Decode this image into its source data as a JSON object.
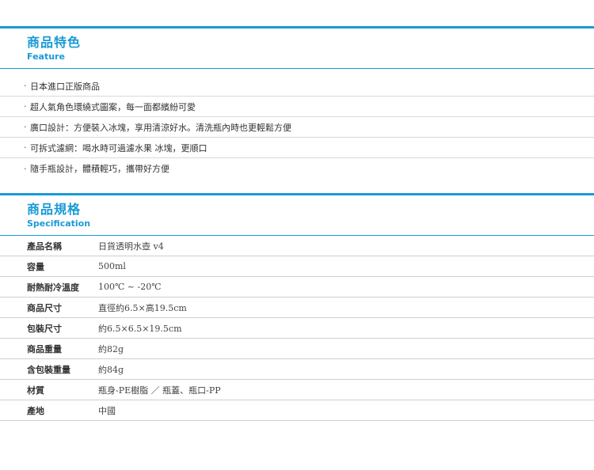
{
  "feature": {
    "title": "商品特色",
    "subtitle": "Feature",
    "bullet": "·",
    "items": [
      "日本進口正版商品",
      "超人氣角色環繞式圖案，每一面都繽紛可愛",
      "廣口設計：方便裝入冰塊，享用清涼好水。清洗瓶內時也更輕鬆方便",
      "可拆式濾網：喝水時可過濾水果 冰塊，更順口",
      "隨手瓶設計，體積輕巧，攜帶好方便"
    ]
  },
  "spec": {
    "title": "商品規格",
    "subtitle": "Specification",
    "rows": [
      {
        "label": "產品名稱",
        "value": "日貨透明水壺 v4"
      },
      {
        "label": "容量",
        "value": "500ml"
      },
      {
        "label": "耐熱耐冷溫度",
        "value": "100℃ ~ -20℃"
      },
      {
        "label": "商品尺寸",
        "value": "直徑約6.5×高19.5cm"
      },
      {
        "label": "包裝尺寸",
        "value": "約6.5×6.5×19.5cm"
      },
      {
        "label": "商品重量",
        "value": "約82g"
      },
      {
        "label": "含包裝重量",
        "value": "約84g"
      },
      {
        "label": "材質",
        "value": "瓶身-PE樹脂 ／ 瓶蓋、瓶口-PP"
      },
      {
        "label": "產地",
        "value": "中國"
      }
    ]
  },
  "colors": {
    "accent": "#1a9ad6",
    "divider": "#d9d9d9"
  }
}
